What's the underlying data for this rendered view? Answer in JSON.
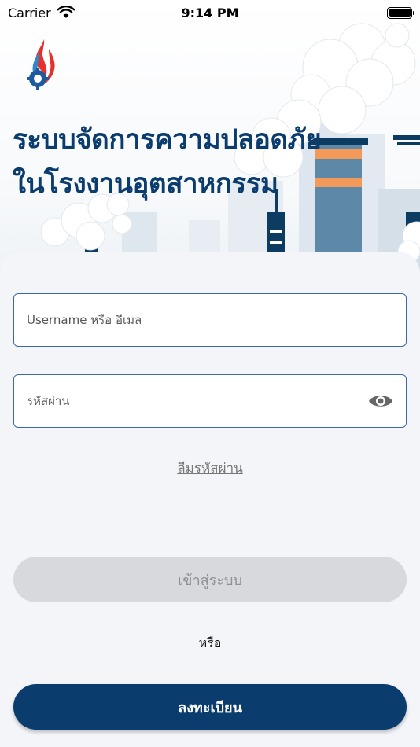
{
  "status_bar": {
    "carrier": "Carrier",
    "time": "9:14 PM"
  },
  "header": {
    "title_line1": "ระบบจัดการความปลอดภัย",
    "title_line2": "ในโรงงานอุตสาหกรรม"
  },
  "form": {
    "username_placeholder": "Username หรือ อีเมล",
    "username_value": "",
    "password_placeholder": "รหัสผ่าน",
    "password_value": "",
    "forgot_label": "ลืมรหัสผ่าน"
  },
  "actions": {
    "login_label": "เข้าสู่ระบบ",
    "or_label": "หรือ",
    "register_label": "ลงทะเบียน"
  },
  "icons": {
    "wifi": "wifi-icon",
    "battery": "battery-icon",
    "eye": "eye-icon",
    "logo": "logo-icon"
  },
  "colors": {
    "brand": "#0b3c6e",
    "field_border": "#3b6aa8",
    "disabled_button": "#d8d9dd",
    "background": "#f3f5f9"
  }
}
